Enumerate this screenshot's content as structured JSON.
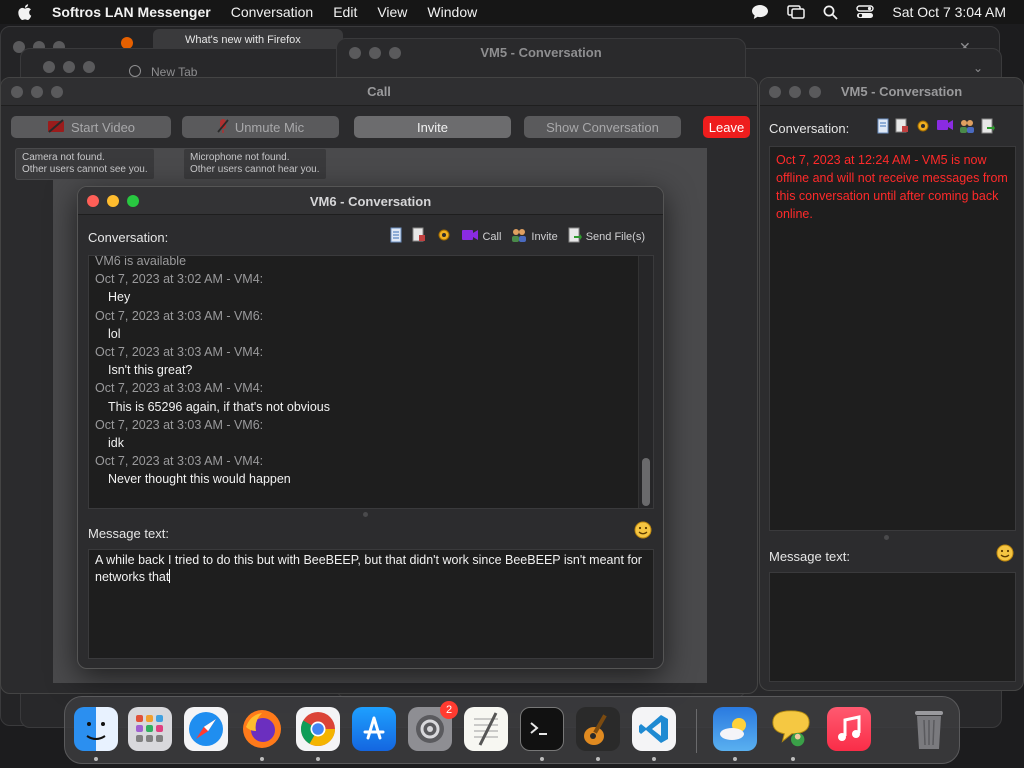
{
  "menubar": {
    "app_name": "Softros LAN Messenger",
    "items": [
      "Conversation",
      "Edit",
      "View",
      "Window"
    ],
    "clock": "Sat Oct 7  3:04 AM"
  },
  "background": {
    "tab_1": "What's new with Firefox",
    "tab_2": "New Tab",
    "vm5_title_behind": "VM5 - Conversation"
  },
  "call_window": {
    "title": "Call",
    "start_video": "Start Video",
    "unmute_mic": "Unmute Mic",
    "invite": "Invite",
    "show_conversation": "Show Conversation",
    "leave": "Leave",
    "camera_tip_1": "Camera not found.",
    "camera_tip_2": "Other users cannot see you.",
    "mic_tip_1": "Microphone not found.",
    "mic_tip_2": "Other users cannot hear you."
  },
  "vm6_window": {
    "title": "VM6 - Conversation",
    "conversation_label": "Conversation:",
    "call_label": "Call",
    "invite_label": "Invite",
    "send_files_label": "Send File(s)",
    "message_label": "Message text:",
    "messages": [
      {
        "meta": "VM6 is available"
      },
      {
        "meta": "Oct 7, 2023 at 3:02 AM - VM4:",
        "body": "Hey"
      },
      {
        "meta": "Oct 7, 2023 at 3:03 AM - VM6:",
        "body": "lol"
      },
      {
        "meta": "Oct 7, 2023 at 3:03 AM - VM4:",
        "body": "Isn't this great?"
      },
      {
        "meta": "Oct 7, 2023 at 3:03 AM - VM4:",
        "body": "This is 65296 again, if that's not obvious"
      },
      {
        "meta": "Oct 7, 2023 at 3:03 AM - VM6:",
        "body": "idk"
      },
      {
        "meta": "Oct 7, 2023 at 3:03 AM - VM4:",
        "body": "Never thought this would happen"
      }
    ],
    "draft_text": "A while back I tried to do this but with BeeBEEP, but that didn't work since BeeBEEP isn't meant for networks that"
  },
  "vm5_window": {
    "title": "VM5 - Conversation",
    "conversation_label": "Conversation:",
    "offline_notice": "Oct 7, 2023 at 12:24 AM - VM5 is now offline and will not receive messages from this conversation until after coming back online.",
    "message_label": "Message text:"
  },
  "dock": {
    "settings_badge": "2",
    "apps": [
      "finder",
      "launchpad",
      "safari",
      "firefox",
      "chrome",
      "app-store",
      "system-settings",
      "textedit",
      "terminal",
      "garageband",
      "vscode",
      "weather",
      "softros-lan-messenger",
      "music",
      "trash"
    ]
  },
  "colors": {
    "leave_red": "#ee1d1d",
    "offline_red": "#ff2a2a"
  }
}
